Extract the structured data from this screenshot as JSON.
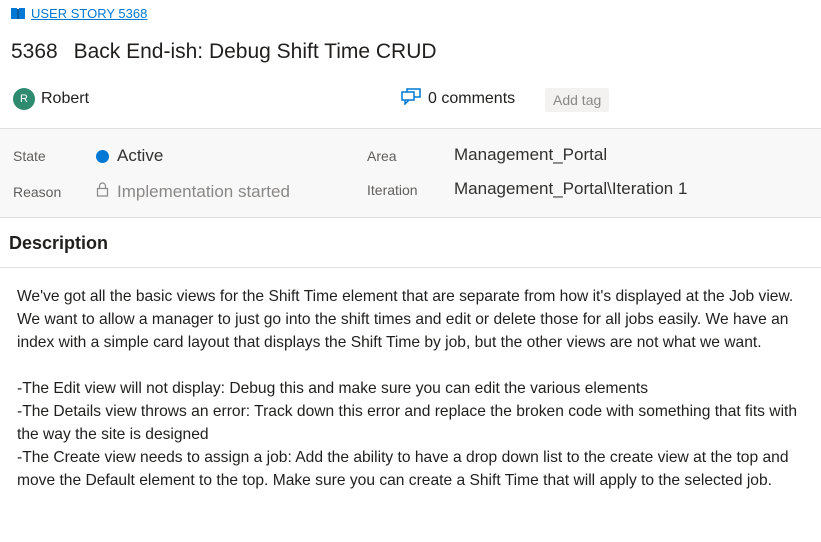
{
  "story_link": {
    "label": "USER STORY 5368",
    "icon": "book-icon"
  },
  "title": {
    "id": "5368",
    "text": "Back End-ish: Debug Shift Time CRUD"
  },
  "owner": {
    "initial": "R",
    "name": "Robert",
    "avatar_color": "#2e8b6f"
  },
  "comments": {
    "label": "0 comments",
    "icon": "comments-icon"
  },
  "tags": {
    "add_label": "Add tag"
  },
  "fields": {
    "state": {
      "label": "State",
      "value": "Active",
      "dot_color": "#0078d4"
    },
    "reason": {
      "label": "Reason",
      "value": "Implementation started",
      "icon": "lock-icon"
    },
    "area": {
      "label": "Area",
      "value": "Management_Portal"
    },
    "iteration": {
      "label": "Iteration",
      "value": "Management_Portal\\Iteration 1"
    }
  },
  "description": {
    "heading": "Description",
    "paragraphs": [
      "We've got all the basic views for the Shift Time element that are separate from how it's displayed at the Job view. We want to allow a manager to just go into the shift times and edit or delete those for all jobs easily. We have an index with a simple card layout that displays the Shift Time by job, but the other views are not what we want.",
      "-The Edit view will not display: Debug this and make sure you can edit the various elements",
      "-The Details view throws an error: Track down this error and replace the broken code with something that fits with the way the site is designed",
      "-The Create view needs to assign a job: Add the ability to have a drop down list to the create view at the top and move the Default element to the top. Make sure you can create a Shift Time that will apply to the selected job."
    ]
  }
}
